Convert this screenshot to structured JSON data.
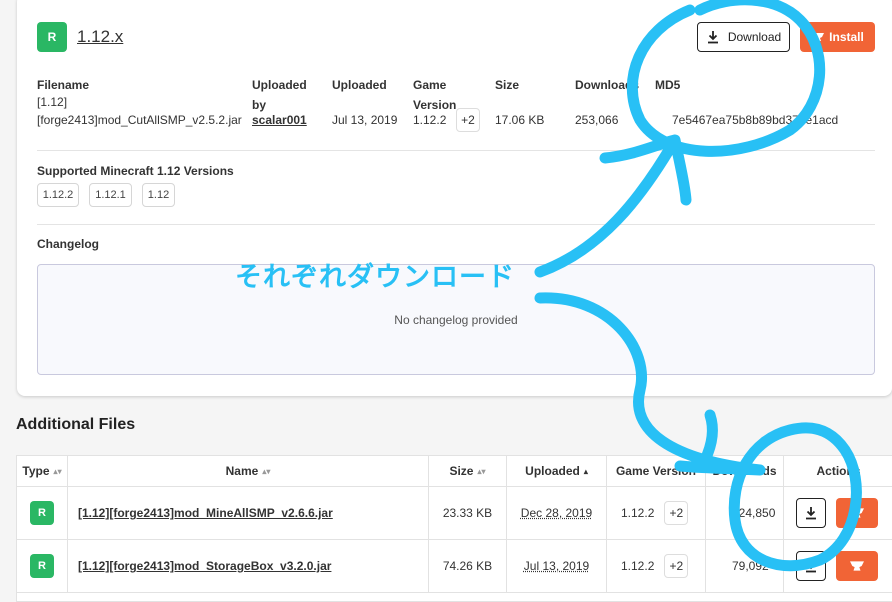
{
  "file": {
    "badge": "R",
    "title": "1.12.x",
    "download_label": "Download",
    "install_label": "Install"
  },
  "meta": {
    "headers": {
      "filename": "Filename",
      "uploaded_by_1": "Uploaded",
      "uploaded_by_2": "by",
      "uploaded": "Uploaded",
      "game_version_1": "Game",
      "game_version_2": "Version",
      "size": "Size",
      "downloads": "Downloads",
      "md5": "MD5"
    },
    "values": {
      "filename_1": "[1.12]",
      "filename_2": "[forge2413]mod_CutAllSMP_v2.5.2.jar",
      "uploaded_by": "scalar001",
      "uploaded": "Jul 13, 2019",
      "game_version": "1.12.2",
      "game_version_more": "+2",
      "size": "17.06 KB",
      "downloads": "253,066",
      "md5": "7e5467ea75b8b89bd373e1acd"
    }
  },
  "supported": {
    "title": "Supported Minecraft 1.12 Versions",
    "versions": [
      "1.12.2",
      "1.12.1",
      "1.12"
    ]
  },
  "changelog": {
    "title": "Changelog",
    "empty_text": "No changelog provided"
  },
  "additional": {
    "title": "Additional Files",
    "columns": [
      "Type",
      "Name",
      "Size",
      "Uploaded",
      "Game Version",
      "Downloads",
      "Actions"
    ],
    "rows": [
      {
        "type": "R",
        "name": "[1.12][forge2413]mod_MineAllSMP_v2.6.6.jar",
        "size": "23.33 KB",
        "uploaded": "Dec 28, 2019",
        "game_version": "1.12.2",
        "more": "+2",
        "downloads": "124,850"
      },
      {
        "type": "R",
        "name": "[1.12][forge2413]mod_StorageBox_v3.2.0.jar",
        "size": "74.26 KB",
        "uploaded": "Jul 13, 2019",
        "game_version": "1.12.2",
        "more": "+2",
        "downloads": "79,092"
      }
    ]
  },
  "annotation": {
    "text": "それぞれダウンロード",
    "color": "#28c0f5"
  },
  "colors": {
    "accent_green": "#2ab764",
    "install_orange": "#f16436"
  }
}
